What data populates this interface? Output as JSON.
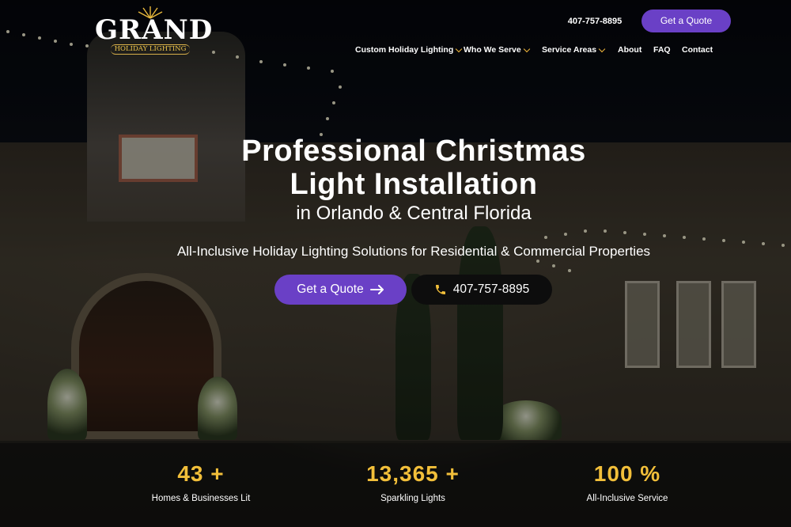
{
  "header": {
    "logo_word": "GRAND",
    "logo_sub": "HOLIDAY LIGHTING",
    "phone": "407-757-8895",
    "quote_label": "Get a Quote"
  },
  "nav": {
    "items": [
      {
        "label": "Custom Holiday Lighting",
        "dropdown": true
      },
      {
        "label": "Who We Serve",
        "dropdown": true
      },
      {
        "label": "Service Areas",
        "dropdown": true
      },
      {
        "label": "About",
        "dropdown": false
      },
      {
        "label": "FAQ",
        "dropdown": false
      },
      {
        "label": "Contact",
        "dropdown": false
      }
    ]
  },
  "hero": {
    "title_line1": "Professional Christmas",
    "title_line2": "Light Installation",
    "subtitle": "in Orlando & Central Florida",
    "tagline": "All-Inclusive Holiday Lighting Solutions for Residential & Commercial Properties",
    "quote_button": "Get a Quote",
    "phone_button": "407-757-8895"
  },
  "stats": [
    {
      "value": "43 +",
      "label": "Homes & Businesses Lit"
    },
    {
      "value": "13,365 +",
      "label": "Sparkling Lights"
    },
    {
      "value": "100 %",
      "label": "All-Inclusive Service"
    }
  ],
  "colors": {
    "accent_purple": "#6a40c6",
    "accent_gold": "#f2bf3a",
    "chevron_gold": "#f0b73c"
  }
}
